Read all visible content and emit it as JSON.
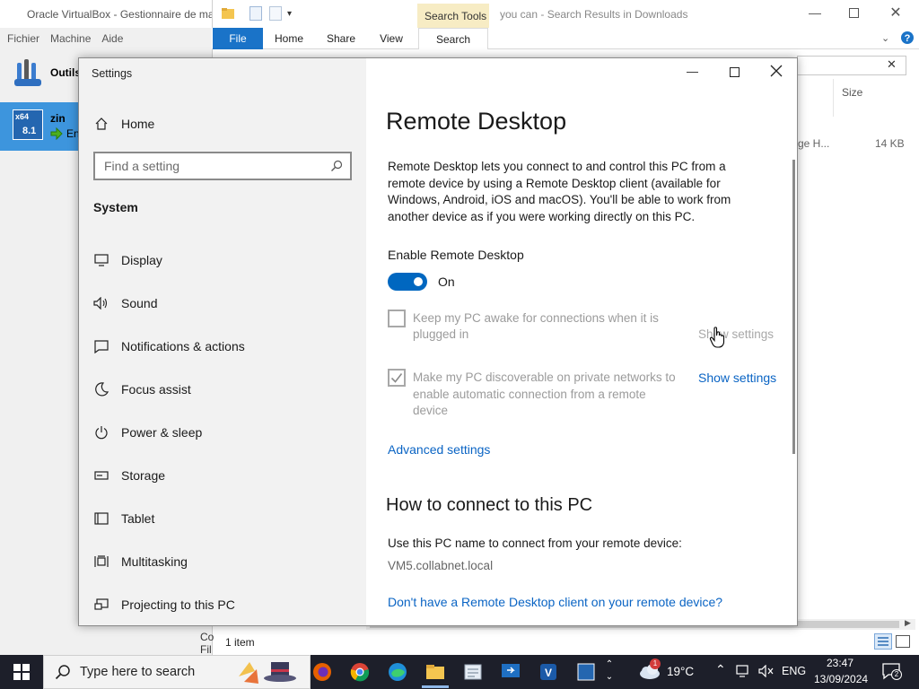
{
  "vbox": {
    "title": "Oracle VirtualBox - Gestionnaire de mac",
    "menu": [
      "Fichier",
      "Machine",
      "Aide"
    ],
    "tools_label": "Outils",
    "vm_name": "zin",
    "vm_state": "En",
    "vm_badge_top": "x64",
    "vm_badge_bottom": "8.1"
  },
  "explorer": {
    "title": "you can - Search Results in Downloads",
    "contextual_tab": "Search Tools",
    "tabs": [
      "File",
      "Home",
      "Share",
      "View",
      "Search"
    ],
    "column_size": "Size",
    "row_name": "ge H...",
    "row_size": "14 KB",
    "status_count": "1 item",
    "status_left_1": "Co",
    "status_left_2": "Fil",
    "search_clear": "✕"
  },
  "settings": {
    "window_title": "Settings",
    "sidebar": {
      "home": "Home",
      "search_placeholder": "Find a setting",
      "section": "System",
      "items": [
        "Display",
        "Sound",
        "Notifications & actions",
        "Focus assist",
        "Power & sleep",
        "Storage",
        "Tablet",
        "Multitasking",
        "Projecting to this PC"
      ]
    },
    "content": {
      "heading": "Remote Desktop",
      "description": "Remote Desktop lets you connect to and control this PC from a remote device by using a Remote Desktop client (available for Windows, Android, iOS and macOS). You'll be able to work from another device as if you were working directly on this PC.",
      "enable_label": "Enable Remote Desktop",
      "toggle_state": "On",
      "keep_awake_line1": "Keep my PC awake for connections when it is",
      "keep_awake_line2": "plugged in",
      "show_settings_1": "Show settings",
      "discoverable_line1": "Make my PC discoverable on private networks to",
      "discoverable_line2": "enable automatic connection from a remote",
      "discoverable_line3": "device",
      "show_settings_2": "Show settings",
      "advanced_settings": "Advanced settings",
      "how_heading": "How to connect to this PC",
      "use_pc_name": "Use this PC name to connect from your remote device:",
      "pc_name": "VM5.collabnet.local",
      "no_client_link": "Don't have a Remote Desktop client on your remote device?"
    }
  },
  "taskbar": {
    "search_placeholder": "Type here to search",
    "weather": "19°C",
    "weather_badge": "1",
    "language": "ENG",
    "time": "23:47",
    "date": "13/09/2024",
    "notification_count": "2"
  },
  "colors": {
    "accent": "#0067c0",
    "link": "#0a64c4",
    "taskbar": "#1d1f2a",
    "sidebar": "#f2f2f2"
  }
}
